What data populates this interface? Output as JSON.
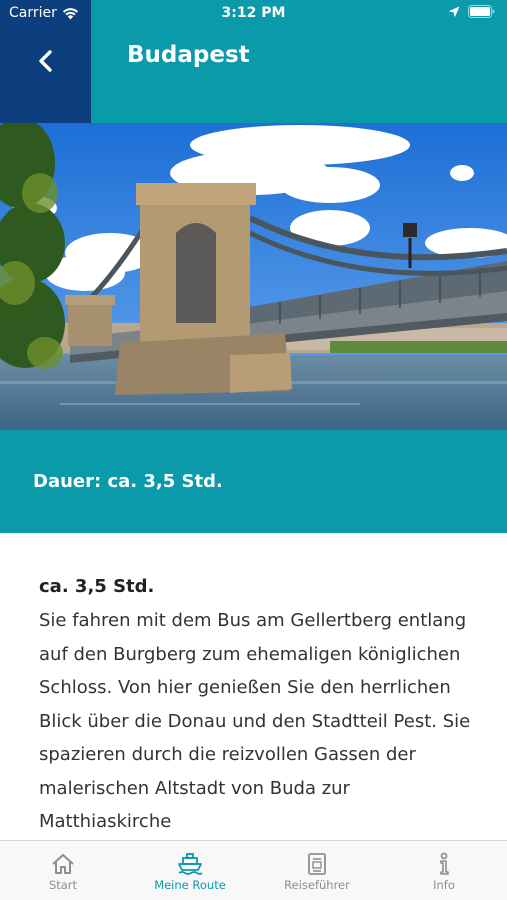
{
  "status_bar": {
    "carrier": "Carrier",
    "time": "3:12 PM"
  },
  "header": {
    "title": "Budapest"
  },
  "duration_band": {
    "text": "Dauer: ca. 3,5 Std."
  },
  "content": {
    "heading": "ca. 3,5 Std.",
    "body": "Sie fahren mit dem Bus am Gellertberg entlang auf den Burgberg zum ehemaligen königlichen Schloss. Von hier genießen Sie den herrlichen Blick über die Donau und den Stadtteil Pest. Sie spazieren durch die reizvollen Gassen der malerischen Altstadt von Buda zur Matthiaskirche"
  },
  "tabbar": {
    "tabs": [
      {
        "label": "Start",
        "icon": "home-icon",
        "active": false
      },
      {
        "label": "Meine Route",
        "icon": "ship-icon",
        "active": true
      },
      {
        "label": "Reiseführer",
        "icon": "guidebook-icon",
        "active": false
      },
      {
        "label": "Info",
        "icon": "info-icon",
        "active": false
      }
    ]
  },
  "colors": {
    "teal": "#0a9aaa",
    "navy": "#0d3f7e",
    "inactive_tab": "#8e8e8e"
  }
}
